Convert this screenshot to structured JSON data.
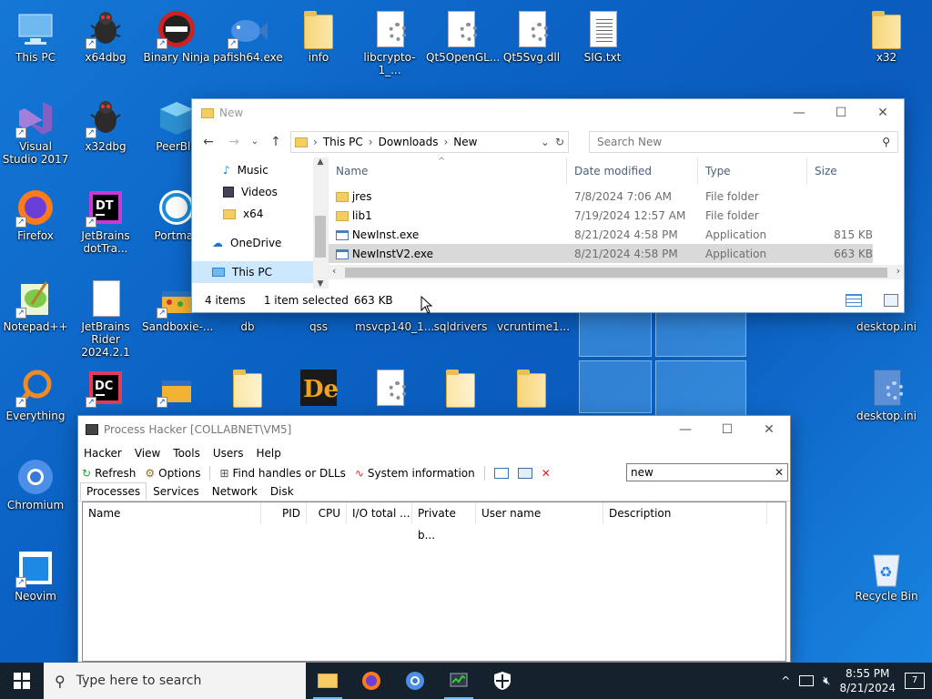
{
  "desktop": {
    "icons": [
      {
        "label": "This PC"
      },
      {
        "label": "x64dbg"
      },
      {
        "label": "Binary Ninja"
      },
      {
        "label": "pafish64.exe"
      },
      {
        "label": "info"
      },
      {
        "label": "libcrypto-1_..."
      },
      {
        "label": "Qt5OpenGL..."
      },
      {
        "label": "Qt5Svg.dll"
      },
      {
        "label": "SIG.txt"
      },
      {
        "label": "x32"
      },
      {
        "label": "Visual Studio 2017"
      },
      {
        "label": "x32dbg"
      },
      {
        "label": "PeerBlo"
      },
      {
        "label": "Firefox"
      },
      {
        "label": "JetBrains dotTra..."
      },
      {
        "label": "Portmas"
      },
      {
        "label": "Notepad++"
      },
      {
        "label": "JetBrains Rider 2024.2.1"
      },
      {
        "label": "Sandboxie-..."
      },
      {
        "label": "db"
      },
      {
        "label": "qss"
      },
      {
        "label": "msvcp140_1..."
      },
      {
        "label": "sqldrivers"
      },
      {
        "label": "vcruntime1..."
      },
      {
        "label": "desktop.ini"
      },
      {
        "label": "Everything"
      },
      {
        "label": "desktop.ini"
      },
      {
        "label": "Chromium"
      },
      {
        "label": "Neovim"
      },
      {
        "label": "Recycle Bin"
      }
    ]
  },
  "explorer": {
    "title": "New",
    "breadcrumb": [
      "This PC",
      "Downloads",
      "New"
    ],
    "search_placeholder": "Search New",
    "nav": [
      "Music",
      "Videos",
      "x64",
      "OneDrive",
      "This PC"
    ],
    "columns": [
      "Name",
      "Date modified",
      "Type",
      "Size"
    ],
    "files": [
      {
        "name": "jres",
        "date": "7/8/2024 7:06 AM",
        "type": "File folder",
        "size": ""
      },
      {
        "name": "lib1",
        "date": "7/19/2024 12:57 AM",
        "type": "File folder",
        "size": ""
      },
      {
        "name": "NewInst.exe",
        "date": "8/21/2024 4:58 PM",
        "type": "Application",
        "size": "815 KB"
      },
      {
        "name": "NewInstV2.exe",
        "date": "8/21/2024 4:58 PM",
        "type": "Application",
        "size": "663 KB"
      }
    ],
    "status": {
      "count": "4 items",
      "selected": "1 item selected",
      "size": "663 KB"
    }
  },
  "ph": {
    "title": "Process Hacker [COLLABNET\\VM5]",
    "menu": [
      "Hacker",
      "View",
      "Tools",
      "Users",
      "Help"
    ],
    "toolbar": [
      "Refresh",
      "Options",
      "Find handles or DLLs",
      "System information"
    ],
    "filter_value": "new",
    "tabs": [
      "Processes",
      "Services",
      "Network",
      "Disk"
    ],
    "columns": [
      "Name",
      "PID",
      "CPU",
      "I/O total ...",
      "Private b...",
      "User name",
      "Description"
    ]
  },
  "taskbar": {
    "search_placeholder": "Type here to search",
    "time": "8:55 PM",
    "date": "8/21/2024",
    "notifications": "7"
  }
}
